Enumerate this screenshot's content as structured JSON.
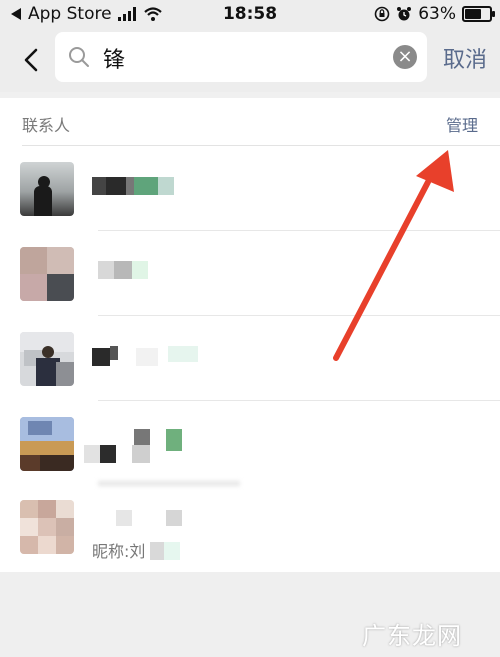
{
  "status_bar": {
    "back_app": "App Store",
    "time": "18:58",
    "battery": "63%"
  },
  "search": {
    "query": "锋",
    "cancel_label": "取消"
  },
  "section": {
    "title": "联系人",
    "manage_label": "管理"
  },
  "contacts": [
    {
      "name_visible": "",
      "nickname": ""
    },
    {
      "name_visible": "",
      "nickname": ""
    },
    {
      "name_visible": "",
      "nickname": ""
    },
    {
      "name_visible": "",
      "nickname": ""
    },
    {
      "name_visible": "",
      "nickname": "昵称:刘"
    }
  ],
  "watermark": "广东龙网",
  "colors": {
    "accent": "#5a6b8c",
    "arrow": "#e8402b"
  }
}
